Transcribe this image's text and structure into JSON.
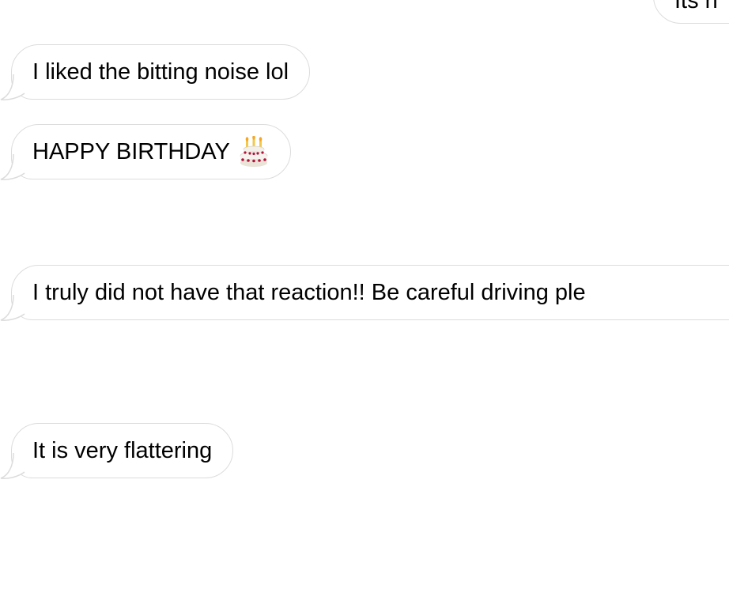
{
  "conversation": {
    "messages": [
      {
        "direction": "outgoing",
        "text": "Its n"
      },
      {
        "direction": "incoming",
        "text": "I liked the bitting noise lol"
      },
      {
        "direction": "incoming",
        "text": "HAPPY BIRTHDAY",
        "emoji": "birthday-cake-icon"
      },
      {
        "direction": "incoming",
        "text": "I truly did not have that reaction!! Be careful driving ple"
      },
      {
        "direction": "incoming",
        "text": "It is very flattering"
      }
    ]
  },
  "colors": {
    "background": "#ffffff",
    "bubble_fill": "#ffffff",
    "bubble_border": "#dcdcdc",
    "text": "#000000"
  }
}
